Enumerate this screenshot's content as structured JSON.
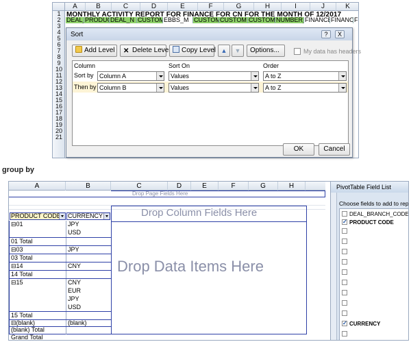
{
  "top": {
    "columns": [
      "A",
      "B",
      "C",
      "D",
      "E",
      "F",
      "G",
      "H",
      "I",
      "J",
      "K"
    ],
    "rows": [
      "1",
      "2",
      "3",
      "4",
      "5",
      "6",
      "7",
      "8",
      "9",
      "10",
      "11",
      "12",
      "13",
      "14",
      "15",
      "16",
      "17",
      "18",
      "19",
      "20",
      "21"
    ],
    "title": "MONTHLY ACTIVITY REPORT FOR FINANCE FOR CN FOR THE MONTH OF 12/2017",
    "headers": [
      "DEAL_B",
      "PRODUC",
      "DEAL_N",
      "CUSTOM",
      "EBBS_M",
      "CUSTOM",
      "CUSTOM",
      "CUSTOM",
      "NUMBER_",
      "FINANCE",
      "FINANCE",
      "FIN"
    ]
  },
  "dialog": {
    "title": "Sort",
    "add_level": "Add Level",
    "delete_level": "Delete Level",
    "copy_level": "Copy Level",
    "options": "Options...",
    "my_data_headers": "My data has headers",
    "col_header": "Column",
    "sort_on_header": "Sort On",
    "order_header": "Order",
    "rows": [
      {
        "label": "Sort by",
        "column": "Column A",
        "sort_on": "Values",
        "order": "A to Z"
      },
      {
        "label": "Then by",
        "column": "Column B",
        "sort_on": "Values",
        "order": "A to Z"
      }
    ],
    "ok": "OK",
    "cancel": "Cancel",
    "help": "?",
    "close": "X"
  },
  "caption": "group by",
  "pivot": {
    "columns": [
      "A",
      "B",
      "C",
      "D",
      "E",
      "F",
      "G",
      "H"
    ],
    "drop_page": "Drop Page Fields Here",
    "drop_column": "Drop Column Fields Here",
    "drop_data": "Drop Data Items Here",
    "field_product": "PRODUCT CODE",
    "field_currency": "CURRENCY",
    "rows": [
      {
        "a": "⊟01",
        "b": "JPY"
      },
      {
        "a": "",
        "b": "USD"
      },
      {
        "a": "01 Total",
        "b": ""
      },
      {
        "a": "⊟03",
        "b": "JPY"
      },
      {
        "a": "03 Total",
        "b": ""
      },
      {
        "a": "⊟14",
        "b": "CNY"
      },
      {
        "a": "14 Total",
        "b": ""
      },
      {
        "a": "⊟15",
        "b": "CNY"
      },
      {
        "a": "",
        "b": "EUR"
      },
      {
        "a": "",
        "b": "JPY"
      },
      {
        "a": "",
        "b": "USD"
      },
      {
        "a": "15 Total",
        "b": ""
      },
      {
        "a": "⊟(blank)",
        "b": "(blank)"
      },
      {
        "a": "(blank) Total",
        "b": ""
      },
      {
        "a": "Grand Total",
        "b": ""
      }
    ]
  },
  "pane": {
    "title": "PivotTable Field List",
    "choose": "Choose fields to add to report:",
    "fields": [
      {
        "label": "DEAL_BRANCH_CODE",
        "checked": false,
        "bold": false
      },
      {
        "label": "PRODUCT CODE",
        "checked": true,
        "bold": true
      },
      {
        "label": "CURRENCY",
        "checked": true,
        "bold": true
      }
    ]
  }
}
